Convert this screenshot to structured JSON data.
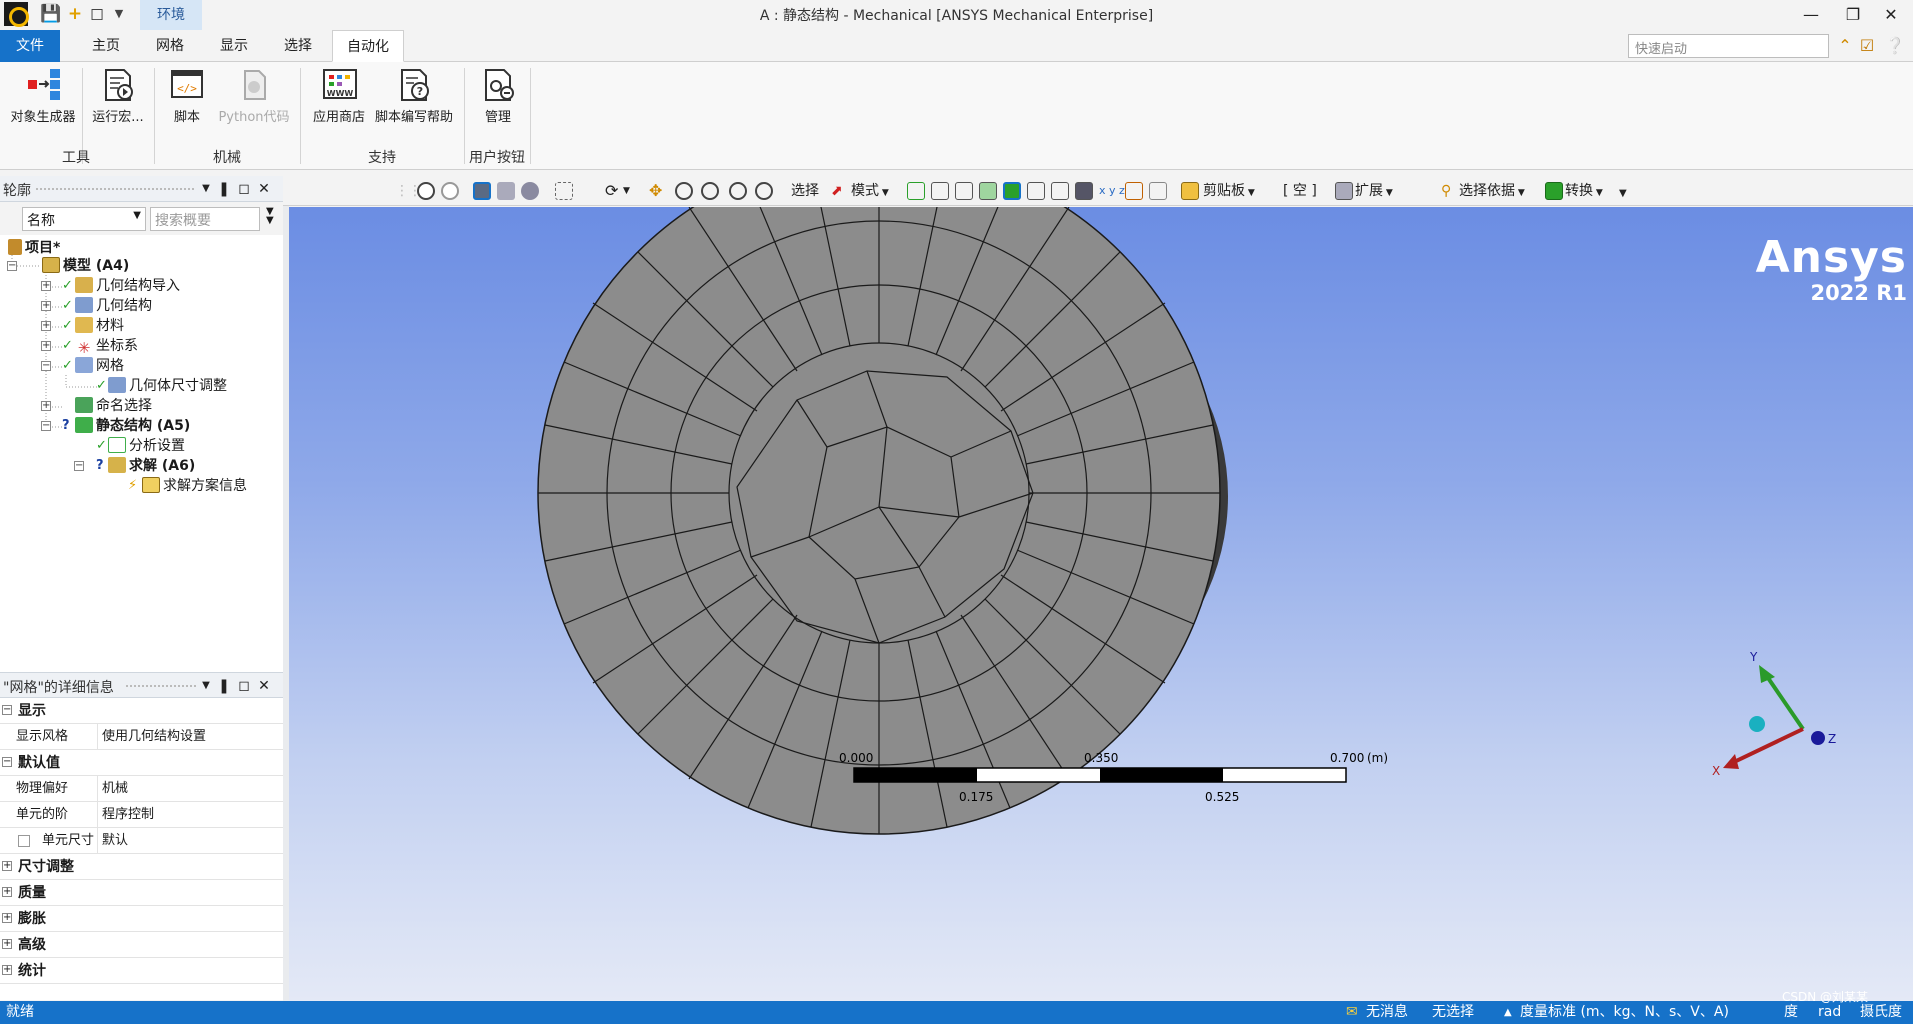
{
  "window": {
    "title": "A : 静态结构 - Mechanical [ANSYS Mechanical Enterprise]",
    "context_tab": "环境"
  },
  "ribbon_tabs": [
    "文件",
    "主页",
    "网格",
    "显示",
    "选择",
    "自动化"
  ],
  "active_tab": "自动化",
  "quick_launch": {
    "placeholder": "快速启动"
  },
  "ribbon": {
    "buttons": {
      "object_generator": "对象生成器",
      "run_macro": "运行宏...",
      "script": "脚本",
      "python_code": "Python代码",
      "app_store": "应用商店",
      "script_help": "脚本编写帮助",
      "manage": "管理"
    },
    "groups": {
      "tools": "工具",
      "mechanical": "机械",
      "support": "支持",
      "user_buttons": "用户按钮"
    }
  },
  "outline": {
    "title": "轮廓",
    "filter_select": "名称",
    "search_placeholder": "搜索概要",
    "tree": [
      {
        "label": "项目*",
        "bold": true
      },
      {
        "label": "模型 (A4)",
        "bold": true
      },
      {
        "label": "几何结构导入"
      },
      {
        "label": "几何结构"
      },
      {
        "label": "材料"
      },
      {
        "label": "坐标系"
      },
      {
        "label": "网格"
      },
      {
        "label": "几何体尺寸调整"
      },
      {
        "label": "命名选择"
      },
      {
        "label": "静态结构 (A5)",
        "bold": true
      },
      {
        "label": "分析设置"
      },
      {
        "label": "求解 (A6)",
        "bold": true
      },
      {
        "label": "求解方案信息"
      }
    ]
  },
  "details": {
    "title": "\"网格\"的详细信息",
    "rows": [
      {
        "type": "cat",
        "toggle": "−",
        "label": "显示"
      },
      {
        "type": "row",
        "key": "显示风格",
        "value": "使用几何结构设置"
      },
      {
        "type": "cat",
        "toggle": "−",
        "label": "默认值"
      },
      {
        "type": "row",
        "key": "物理偏好",
        "value": "机械"
      },
      {
        "type": "row",
        "key": "单元的阶",
        "value": "程序控制"
      },
      {
        "type": "row",
        "key": "单元尺寸",
        "value": "默认",
        "checkbox": true
      },
      {
        "type": "cat",
        "toggle": "+",
        "label": "尺寸调整"
      },
      {
        "type": "cat",
        "toggle": "+",
        "label": "质量"
      },
      {
        "type": "cat",
        "toggle": "+",
        "label": "膨胀"
      },
      {
        "type": "cat",
        "toggle": "+",
        "label": "高级"
      },
      {
        "type": "cat",
        "toggle": "+",
        "label": "统计"
      }
    ]
  },
  "graphics_toolbar": {
    "select": "选择",
    "mode": "模式",
    "clipboard": "剪贴板",
    "empty": "[ 空 ]",
    "extend": "扩展",
    "select_by": "选择依据",
    "convert": "转换"
  },
  "viewport": {
    "brand": "Ansys",
    "version": "2022 R1",
    "scale_labels": {
      "t0": "0.000",
      "t1": "0.350",
      "t2": "0.700",
      "unit": "(m)",
      "b1": "0.175",
      "b2": "0.525"
    },
    "triad": {
      "x": "X",
      "y": "Y",
      "z": "Z"
    }
  },
  "statusbar": {
    "ready": "就绪",
    "messages": "无消息",
    "selection": "无选择",
    "units": "度量标准 (m、kg、N、s、V、A)",
    "degree": "度",
    "rad": "rad",
    "temp": "摄氏度",
    "watermark": "CSDN @刘某某"
  },
  "colors": {
    "accent": "#1672c9",
    "mesh_fill": "#8c8c8c",
    "mesh_line": "#1a1a1a",
    "check": "#2aa02a"
  }
}
